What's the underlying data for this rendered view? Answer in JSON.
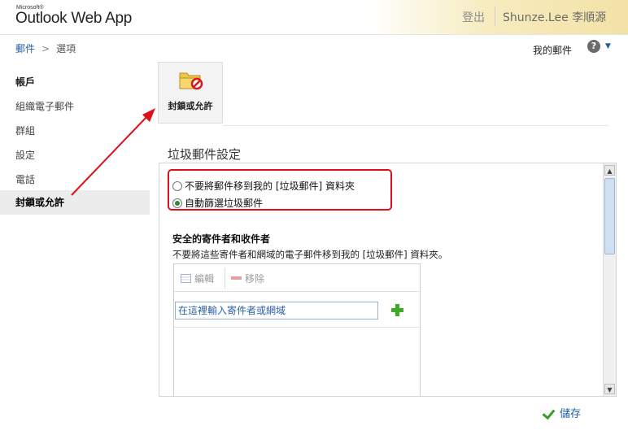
{
  "header": {
    "ms_label": "Microsoft®",
    "app_title": "Outlook Web App",
    "signout_label": "登出",
    "username": "Shunze.Lee 李順源"
  },
  "breadcrumb": {
    "root": "郵件",
    "separator": ">",
    "current": "選項"
  },
  "top_right": {
    "my_mail": "我的郵件",
    "help_glyph": "?",
    "help_caret": "▼"
  },
  "sidebar": {
    "items": [
      {
        "label": "帳戶"
      },
      {
        "label": "組織電子郵件"
      },
      {
        "label": "群組"
      },
      {
        "label": "設定"
      },
      {
        "label": "電話"
      },
      {
        "label": "封鎖或允許"
      }
    ]
  },
  "toolbar": {
    "block_allow_label": "封鎖或允許"
  },
  "junk_settings": {
    "title": "垃圾郵件設定",
    "option_off": "不要將郵件移到我的 [垃圾郵件] 資料夾",
    "option_on": "自動篩選垃圾郵件",
    "selected": "option_on"
  },
  "safe_senders": {
    "title": "安全的寄件者和收件者",
    "description": "不要將這些寄件者和網域的電子郵件移到我的 [垃圾郵件] 資料夾。",
    "edit_label": "編輯",
    "remove_label": "移除",
    "input_placeholder": "在這裡輸入寄件者或網域"
  },
  "footer": {
    "save_label": "儲存"
  },
  "colors": {
    "accent": "#1f5fa8",
    "annotation": "#e0101a",
    "header_gold": "#f3e2a6"
  }
}
